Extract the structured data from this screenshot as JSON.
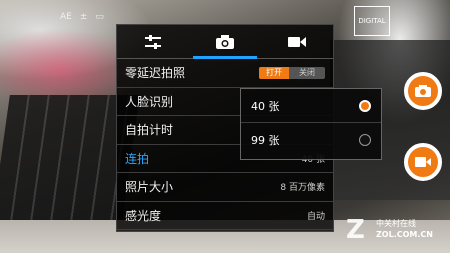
{
  "status_icons": [
    "AE-icon",
    "exposure-icon",
    "flash-icon"
  ],
  "status_text": {
    "ae": "AE",
    "exposure": "±",
    "flash": "▭"
  },
  "tabs": [
    {
      "name": "settings",
      "icon": "sliders-icon",
      "active": false
    },
    {
      "name": "photo",
      "icon": "camera-icon",
      "active": true
    },
    {
      "name": "video",
      "icon": "video-icon",
      "active": false
    }
  ],
  "settings": {
    "zero_lag": {
      "label": "零延迟拍照",
      "toggle_on": "打开",
      "toggle_off": "关闭"
    },
    "face_detect": {
      "label": "人脸识别"
    },
    "self_timer": {
      "label": "自拍计时"
    },
    "burst": {
      "label": "连拍",
      "value": "40 张"
    },
    "photo_size": {
      "label": "照片大小",
      "value": "8 百万像素"
    },
    "iso": {
      "label": "感光度",
      "value": "自动"
    }
  },
  "burst_popup": {
    "options": [
      {
        "label": "40 张",
        "selected": true
      },
      {
        "label": "99 张",
        "selected": false
      }
    ]
  },
  "thumbnail_text": "DIGITAL",
  "watermark": {
    "logo": "Z",
    "cn": "中关村在线",
    "en": "ZOL.COM.CN"
  },
  "colors": {
    "accent": "#f07b15",
    "highlight": "#28a8ff"
  }
}
